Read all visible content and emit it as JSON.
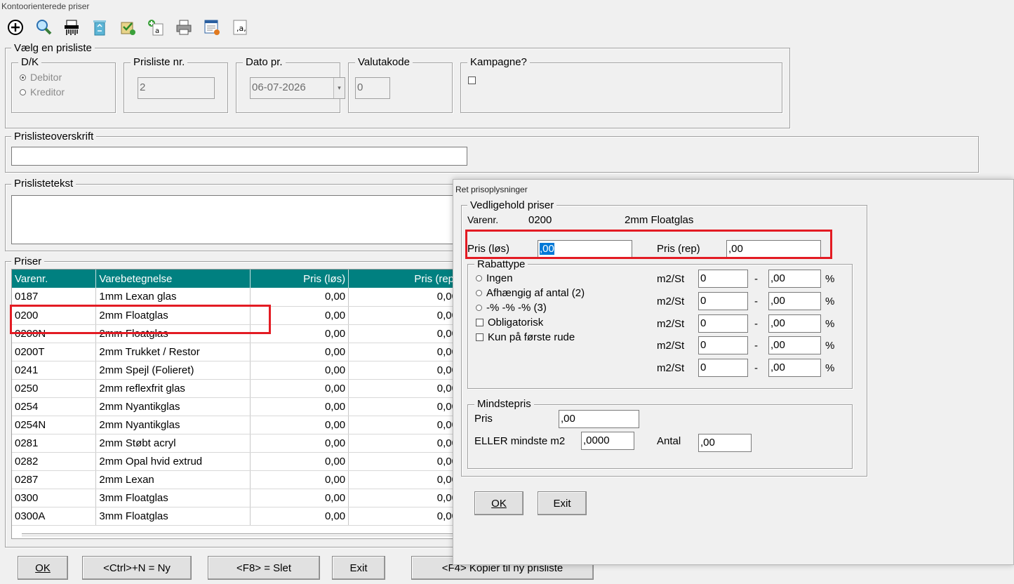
{
  "window": {
    "title": "Kontoorienterede priser"
  },
  "toolbar": {
    "items": [
      {
        "icon": "add-circle-icon"
      },
      {
        "icon": "search-icon"
      },
      {
        "icon": "shredder-icon"
      },
      {
        "icon": "recycle-bin-icon"
      },
      {
        "icon": "approve-icon"
      },
      {
        "icon": "add-price-icon"
      },
      {
        "icon": "printer-icon"
      },
      {
        "icon": "report-icon"
      },
      {
        "icon": "price-tag-icon"
      }
    ]
  },
  "select_group": {
    "title": "Vælg en prisliste",
    "dk": {
      "title": "D/K",
      "debitor": "Debitor",
      "kreditor": "Kreditor",
      "selected": "Debitor"
    },
    "prisliste_nr": {
      "label": "Prisliste nr.",
      "value": "2"
    },
    "dato": {
      "label": "Dato pr.",
      "value": "06-07-2026"
    },
    "valuta": {
      "label": "Valutakode",
      "value": "0"
    },
    "kampagne": {
      "label": "Kampagne?",
      "checked": false
    }
  },
  "overskrift": {
    "title": "Prislisteoverskrift",
    "value": ""
  },
  "tekst": {
    "title": "Prislistetekst",
    "value": ""
  },
  "priser": {
    "title": "Priser",
    "columns": [
      "Varenr.",
      "Varebetegnelse",
      "Pris (løs)",
      "Pris (rep)"
    ],
    "rows": [
      [
        "0187",
        "1mm Lexan glas",
        "0,00",
        "0,00"
      ],
      [
        "0200",
        "2mm Floatglas",
        "0,00",
        "0,00"
      ],
      [
        "0200N",
        "2mm Floatglas",
        "0,00",
        "0,00"
      ],
      [
        "0200T",
        "2mm Trukket / Restor",
        "0,00",
        "0,00"
      ],
      [
        "0241",
        "2mm Spejl (Folieret)",
        "0,00",
        "0,00"
      ],
      [
        "0250",
        "2mm reflexfrit glas",
        "0,00",
        "0,00"
      ],
      [
        "0254",
        "2mm Nyantikglas",
        "0,00",
        "0,00"
      ],
      [
        "0254N",
        "2mm Nyantikglas",
        "0,00",
        "0,00"
      ],
      [
        "0281",
        "2mm Støbt acryl",
        "0,00",
        "0,00"
      ],
      [
        "0282",
        "2mm Opal hvid extrud",
        "0,00",
        "0,00"
      ],
      [
        "0287",
        "2mm Lexan",
        "0,00",
        "0,00"
      ],
      [
        "0300",
        "3mm Floatglas",
        "0,00",
        "0,00"
      ],
      [
        "0300A",
        "3mm Floatglas",
        "0,00",
        "0,00"
      ]
    ]
  },
  "bottom_buttons": {
    "ok": "OK",
    "ny": "<Ctrl>+N = Ny",
    "slet": "<F8> = Slet",
    "exit": "Exit",
    "kopier": "<F4> Kopier til ny prisliste"
  },
  "dialog": {
    "title": "Ret prisoplysninger",
    "group_title": "Vedligehold priser",
    "varenr_label": "Varenr.",
    "varenr": "0200",
    "varenavn": "2mm Floatglas",
    "pris_los_label": "Pris (løs)",
    "pris_los": ",00",
    "pris_rep_label": "Pris (rep)",
    "pris_rep": ",00",
    "rabat": {
      "title": "Rabattype",
      "options": [
        "Ingen",
        "Afhængig af antal (2)",
        "-% -% -% (3)"
      ],
      "checks": [
        "Obligatorisk",
        "Kun på første rude"
      ],
      "unit_label": "m2/St",
      "dash": "-",
      "pct": "%",
      "rows": [
        {
          "qty": "0",
          "val": ",00"
        },
        {
          "qty": "0",
          "val": ",00"
        },
        {
          "qty": "0",
          "val": ",00"
        },
        {
          "qty": "0",
          "val": ",00"
        },
        {
          "qty": "0",
          "val": ",00"
        }
      ]
    },
    "mindste": {
      "title": "Mindstepris",
      "pris_label": "Pris",
      "pris": ",00",
      "m2_label": "ELLER mindste m2",
      "m2": ",0000",
      "antal_label": "Antal",
      "antal": ",00"
    },
    "ok": "OK",
    "exit": "Exit"
  }
}
